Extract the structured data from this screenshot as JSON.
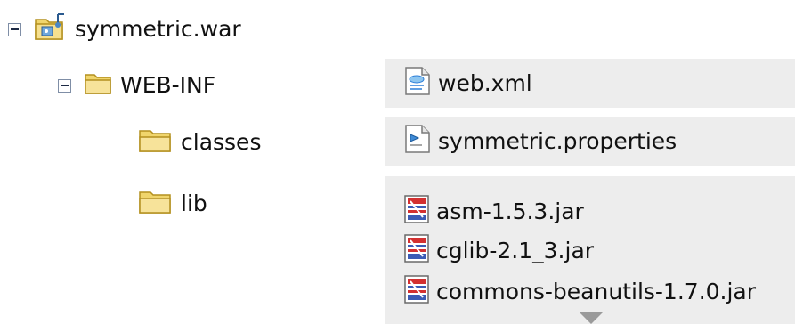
{
  "tree": {
    "root": {
      "label": "symmetric.war",
      "icon": "war-archive-icon"
    },
    "web_inf": {
      "label": "WEB-INF",
      "icon": "folder-icon"
    },
    "classes": {
      "label": "classes",
      "icon": "folder-icon"
    },
    "lib": {
      "label": "lib",
      "icon": "folder-icon"
    }
  },
  "files": {
    "web_inf": [
      {
        "label": "web.xml",
        "icon": "xml-file-icon"
      }
    ],
    "classes": [
      {
        "label": "symmetric.properties",
        "icon": "properties-file-icon"
      }
    ],
    "lib": [
      {
        "label": "asm-1.5.3.jar",
        "icon": "jar-file-icon"
      },
      {
        "label": "cglib-2.1_3.jar",
        "icon": "jar-file-icon"
      },
      {
        "label": "commons-beanutils-1.7.0.jar",
        "icon": "jar-file-icon"
      }
    ]
  },
  "colors": {
    "folder": "#f0d56c",
    "panel": "#ededed",
    "jar_accent": "#d33030",
    "xml_accent": "#2c7ed8"
  }
}
